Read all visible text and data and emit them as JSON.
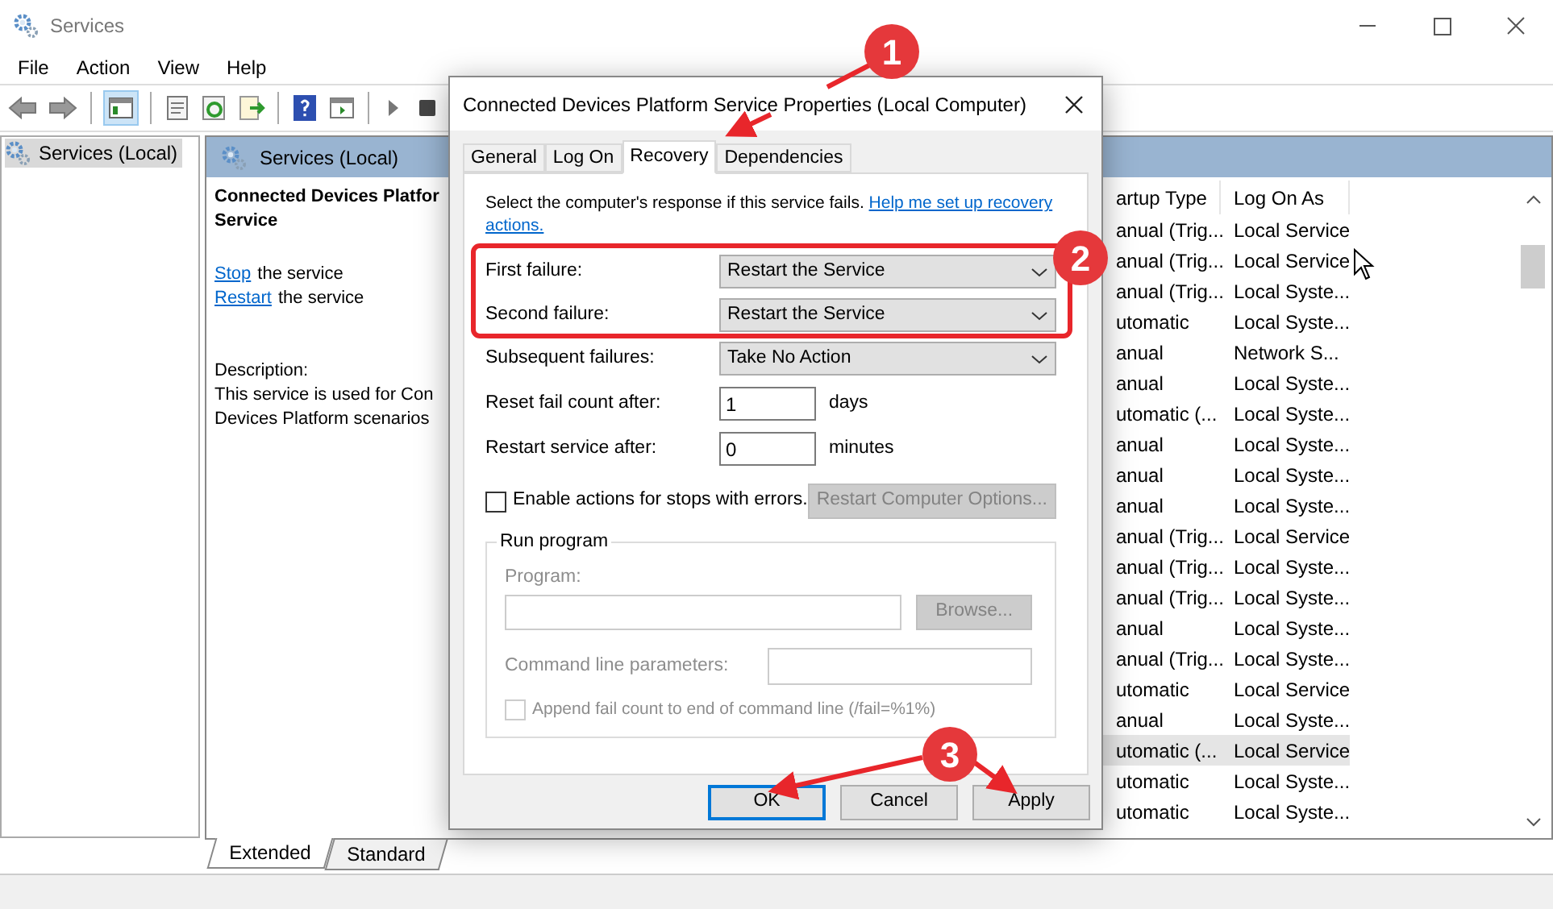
{
  "window": {
    "title": "Services"
  },
  "menu": [
    {
      "label": "File"
    },
    {
      "label": "Action"
    },
    {
      "label": "View"
    },
    {
      "label": "Help"
    }
  ],
  "tree": {
    "items": [
      {
        "label": "Services (Local)",
        "selected": true
      }
    ]
  },
  "details": {
    "header": "Services (Local)",
    "service_name_lines": [
      "Connected Devices Platfor",
      "Service"
    ],
    "actions": [
      {
        "link": "Stop",
        "text": "the service"
      },
      {
        "link": "Restart",
        "text": "the service"
      }
    ],
    "description_label": "Description:",
    "description_lines": [
      "This service is used for Con",
      "Devices Platform scenarios"
    ]
  },
  "table": {
    "columns": [
      "artup Type",
      "Log On As"
    ],
    "rows": [
      {
        "cells": [
          "anual (Trig...",
          "Local Service"
        ],
        "selected": false
      },
      {
        "cells": [
          "anual (Trig...",
          "Local Service"
        ],
        "selected": false
      },
      {
        "cells": [
          "anual (Trig...",
          "Local Syste..."
        ],
        "selected": false
      },
      {
        "cells": [
          "utomatic",
          "Local Syste..."
        ],
        "selected": false
      },
      {
        "cells": [
          "anual",
          "Network S..."
        ],
        "selected": false
      },
      {
        "cells": [
          "anual",
          "Local Syste..."
        ],
        "selected": false
      },
      {
        "cells": [
          "utomatic (...",
          "Local Syste..."
        ],
        "selected": false
      },
      {
        "cells": [
          "anual",
          "Local Syste..."
        ],
        "selected": false
      },
      {
        "cells": [
          "anual",
          "Local Syste..."
        ],
        "selected": false
      },
      {
        "cells": [
          "anual",
          "Local Syste..."
        ],
        "selected": false
      },
      {
        "cells": [
          "anual (Trig...",
          "Local Service"
        ],
        "selected": false
      },
      {
        "cells": [
          "anual (Trig...",
          "Local Syste..."
        ],
        "selected": false
      },
      {
        "cells": [
          "anual (Trig...",
          "Local Syste..."
        ],
        "selected": false
      },
      {
        "cells": [
          "anual",
          "Local Syste..."
        ],
        "selected": false
      },
      {
        "cells": [
          "anual (Trig...",
          "Local Syste..."
        ],
        "selected": false
      },
      {
        "cells": [
          "utomatic",
          "Local Service"
        ],
        "selected": false
      },
      {
        "cells": [
          "anual",
          "Local Syste..."
        ],
        "selected": false
      },
      {
        "cells": [
          "utomatic (...",
          "Local Service"
        ],
        "selected": true
      },
      {
        "cells": [
          "utomatic",
          "Local Syste..."
        ],
        "selected": false
      },
      {
        "cells": [
          "utomatic",
          "Local Syste..."
        ],
        "selected": false
      }
    ]
  },
  "view_tabs": [
    {
      "label": "Extended",
      "selected": true
    },
    {
      "label": "Standard",
      "selected": false
    }
  ],
  "dialog": {
    "title": "Connected Devices Platform Service Properties (Local Computer)",
    "tabs": [
      {
        "label": "General",
        "selected": false
      },
      {
        "label": "Log On",
        "selected": false
      },
      {
        "label": "Recovery",
        "selected": true
      },
      {
        "label": "Dependencies",
        "selected": false
      }
    ],
    "intro": "Select the computer's response if this service fails.",
    "help_link_lines": [
      "Help me set up recovery",
      "actions."
    ],
    "failures": [
      {
        "label": "First failure:",
        "value": "Restart the Service"
      },
      {
        "label": "Second failure:",
        "value": "Restart the Service"
      },
      {
        "label": "Subsequent failures:",
        "value": "Take No Action"
      }
    ],
    "counters": [
      {
        "label": "Reset fail count after:",
        "value": "1",
        "unit": "days"
      },
      {
        "label": "Restart service after:",
        "value": "0",
        "unit": "minutes"
      }
    ],
    "enable_actions": {
      "label": "Enable actions for stops with errors.",
      "checked": false
    },
    "restart_computer_button": {
      "label": "Restart Computer Options...",
      "disabled": true
    },
    "run_program": {
      "title": "Run program",
      "disabled": true,
      "program_label": "Program:",
      "browse": "Browse...",
      "params_label": "Command line parameters:",
      "append": {
        "label": "Append fail count to end of command line (/fail=%1%)",
        "checked": false
      }
    },
    "buttons": [
      {
        "label": "OK",
        "default": true
      },
      {
        "label": "Cancel",
        "default": false
      },
      {
        "label": "Apply",
        "default": false
      }
    ]
  },
  "annotations": [
    {
      "number": "1"
    },
    {
      "number": "2"
    },
    {
      "number": "3"
    }
  ]
}
